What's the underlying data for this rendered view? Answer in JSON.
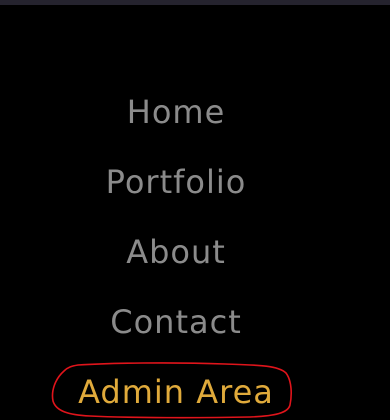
{
  "nav": {
    "items": [
      {
        "label": "Home"
      },
      {
        "label": "Portfolio"
      },
      {
        "label": "About"
      },
      {
        "label": "Contact"
      },
      {
        "label": "Admin Area",
        "active": true
      }
    ]
  },
  "colors": {
    "background": "#000000",
    "top_bar": "#25232e",
    "nav_text": "#8b8b8b",
    "active_text": "#e0aa3b",
    "annotation": "#e0141b"
  }
}
